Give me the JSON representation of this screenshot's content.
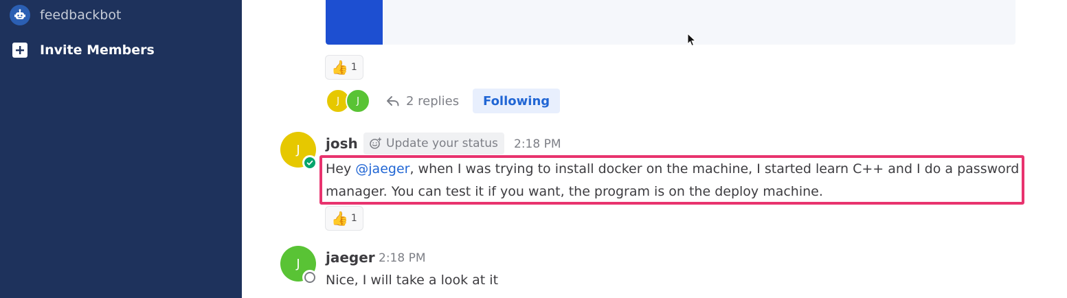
{
  "sidebar": {
    "bot_item": {
      "label": "feedbackbot",
      "icon": "bot-icon"
    },
    "invite_item": {
      "label": "Invite Members",
      "icon": "plus-icon"
    }
  },
  "colors": {
    "sidebar_bg": "#1e325c",
    "accent": "#2166d4",
    "highlight_border": "#e8336e",
    "online": "#06a56b",
    "avatar_josh": "#e6c800",
    "avatar_jaeger": "#59c335"
  },
  "thread": {
    "reaction_top": {
      "emoji": "👍",
      "count": "1"
    },
    "participants": [
      {
        "initial": "J"
      },
      {
        "initial": "J"
      }
    ],
    "replies_label": "2 replies",
    "following_label": "Following"
  },
  "messages": [
    {
      "author": "josh",
      "avatar_initial": "J",
      "status_chip": "Update your status",
      "time": "2:18 PM",
      "text_before": "Hey ",
      "mention": "@jaeger",
      "text_after": ", when I was trying to install docker on the machine, I started learn C++ and I do a password manager. You can test it if you want, the program is on the deploy machine.",
      "reaction": {
        "emoji": "👍",
        "count": "1"
      }
    },
    {
      "author": "jaeger",
      "avatar_initial": "J",
      "time": "2:18 PM",
      "text": "Nice, I will take a look at it"
    }
  ]
}
